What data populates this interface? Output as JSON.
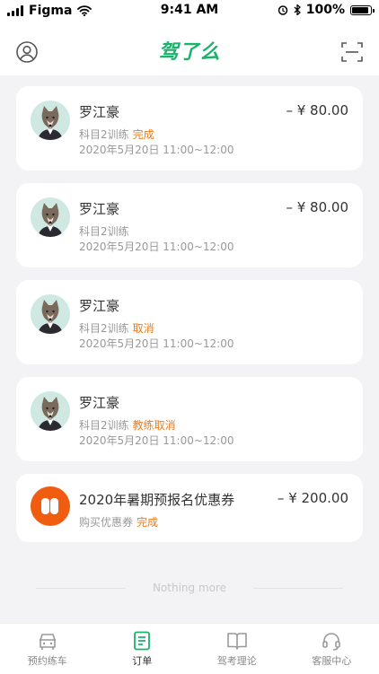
{
  "status_bar": {
    "carrier": "Figma",
    "time": "9:41 AM",
    "battery": "100%"
  },
  "header": {
    "brand": "驾了么"
  },
  "orders": [
    {
      "name": "罗江豪",
      "amount": "– ¥ 80.00",
      "course": "科目2训练",
      "status": "完成",
      "date": "2020年5月20日  11:00~12:00"
    },
    {
      "name": "罗江豪",
      "amount": "– ¥ 80.00",
      "course": "科目2训练",
      "status": "",
      "date": "2020年5月20日  11:00~12:00"
    },
    {
      "name": "罗江豪",
      "amount": "",
      "course": "科目2训练",
      "status": "取消",
      "date": "2020年5月20日  11:00~12:00"
    },
    {
      "name": "罗江豪",
      "amount": "",
      "course": "科目2训练",
      "status": "教练取消",
      "date": "2020年5月20日  11:00~12:00"
    }
  ],
  "coupon": {
    "title": "2020年暑期预报名优惠券",
    "amount": "– ¥ 200.00",
    "desc": "购买优惠券",
    "status": "完成"
  },
  "footer_text": "Nothing more",
  "tabs": [
    {
      "label": "预约练车",
      "icon": "car-icon"
    },
    {
      "label": "订单",
      "icon": "order-icon"
    },
    {
      "label": "驾考理论",
      "icon": "book-icon"
    },
    {
      "label": "客服中心",
      "icon": "headset-icon"
    }
  ],
  "colors": {
    "brand": "#19b36b",
    "status_orange": "#f07a1a",
    "coupon_orange": "#f05d10",
    "active_tab": "#19b36b"
  }
}
